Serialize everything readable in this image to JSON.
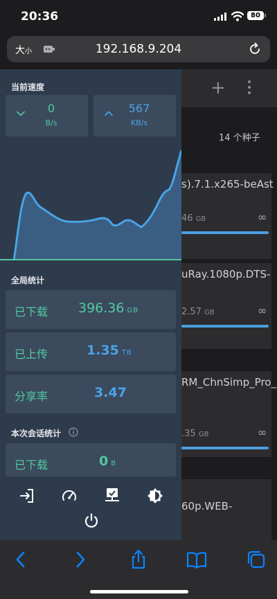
{
  "status_bar": {
    "time": "20:36",
    "battery": "80"
  },
  "url_bar": {
    "font_big": "大",
    "font_small": "小",
    "host": "192.168.9.204"
  },
  "torrent_list": {
    "count_label": "14 个种子",
    "items": [
      {
        "name": "s).7.1.x265-beAst",
        "size": "46",
        "unit": "GB",
        "ratio": "∞"
      },
      {
        "name": "uRay.1080p.DTS-",
        "size": "2.57",
        "unit": "GB",
        "ratio": "∞"
      },
      {
        "name": "RM_ChnSimp_Pro_E",
        "size": ".35",
        "unit": "GB",
        "ratio": "∞"
      },
      {
        "name": "60p.WEB-",
        "size": "",
        "unit": "",
        "ratio": ""
      }
    ]
  },
  "panel": {
    "speed_title": "当前速度",
    "download_speed": {
      "value": "0",
      "unit": "B/s"
    },
    "upload_speed": {
      "value": "567",
      "unit": "KB/s"
    },
    "global_title": "全局统计",
    "global_stats": [
      {
        "label": "已下载",
        "value": "396.36",
        "unit": "GB"
      },
      {
        "label": "已上传",
        "value": "1.35",
        "unit": "TB"
      },
      {
        "label": "分享率",
        "value": "3.47",
        "unit": ""
      }
    ],
    "session_title": "本次会话统计",
    "session_stats": [
      {
        "label": "已下载",
        "value": "0",
        "unit": "B"
      }
    ]
  },
  "icons": {
    "tools": [
      "login-icon",
      "speedometer-icon",
      "network-icon",
      "theme-icon",
      "power-icon"
    ],
    "bottom": [
      "back-icon",
      "forward-icon",
      "share-icon",
      "bookmarks-icon",
      "tabs-icon"
    ]
  },
  "colors": {
    "accent_blue": "#4aa3e8",
    "accent_green": "#52c9a0",
    "panel_bg": "#2e3b4c",
    "card_bg": "#3b4a5d",
    "ios_blue": "#0a84ff"
  }
}
